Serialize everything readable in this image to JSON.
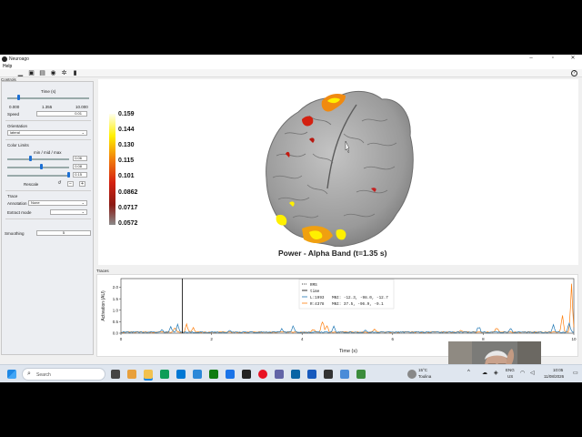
{
  "window": {
    "title": "Neuroago"
  },
  "menu": {
    "help": "Help"
  },
  "toolbar": {
    "icons": [
      "minimize-panel-icon",
      "screenshot-icon",
      "movie-icon",
      "visibility-icon",
      "settings-icon",
      "trash-icon"
    ],
    "help_icon": "?"
  },
  "controls": {
    "title": "Controls",
    "time": {
      "label": "Time (s)",
      "min": "0.000",
      "current": "1.355",
      "max": "10.000",
      "fraction": 0.14
    },
    "speed": {
      "label": "Speed",
      "value": "0.01"
    },
    "orientation": {
      "label": "Orientation",
      "value": "lateral"
    },
    "color_limits": {
      "label": "Color Limits",
      "sublabel": "min / mid / max",
      "min": "0.06",
      "mid": "0.08",
      "max": "0.15",
      "rescale": "Rescale",
      "reset_icon": "↺",
      "minus": "−",
      "plus": "+"
    },
    "trace": {
      "label": "Trace",
      "annotation_label": "Annotation",
      "annotation_value": "None",
      "extract_label": "Extract mode",
      "extract_value": ""
    },
    "smoothing": {
      "label": "Smoothing",
      "value": "5"
    }
  },
  "view": {
    "title": "Power - Alpha Band (t=1.35 s)",
    "colorbar_ticks": [
      "0.159",
      "0.144",
      "0.130",
      "0.115",
      "0.101",
      "0.0862",
      "0.0717",
      "0.0572"
    ],
    "colorbar_colors": {
      "low": "#8a8a8a",
      "mid": "#d42010",
      "high": "#fff000"
    }
  },
  "traces": {
    "label": "Traces",
    "ylabel": "Activation (AU)",
    "xlabel": "Time (s)",
    "yticks": [
      "0.0",
      "0.5",
      "1.0",
      "1.5",
      "2.0"
    ],
    "xticks": [
      "0",
      "2",
      "4",
      "6",
      "8",
      "10"
    ],
    "legend": {
      "rms": "RMS",
      "time": "time",
      "l_label": "L:1993",
      "l_mni": "MNI: -12.3, -98.0, -12.7",
      "r_label": "R:4378",
      "r_mni": "MNI: 37.5, -96.9, -9.1"
    },
    "colors": {
      "left": "#1f77b4",
      "right": "#ff7f0e",
      "time": "#000000"
    },
    "current_time": 1.355
  },
  "taskbar": {
    "search_placeholder": "Search",
    "weather_temp": "15°C",
    "weather_city": "Toulina",
    "lang_top": "ENG",
    "lang_bottom": "US",
    "time": "10:05",
    "date": "11/08/2026"
  }
}
